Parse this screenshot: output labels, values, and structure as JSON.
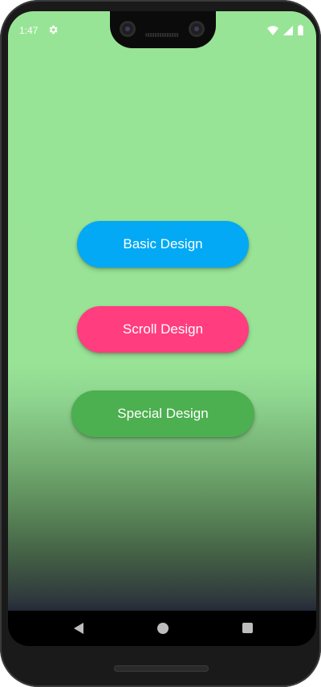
{
  "status_bar": {
    "time": "1:47",
    "icons": [
      "gear-icon",
      "wifi-icon",
      "signal-icon",
      "battery-icon"
    ]
  },
  "buttons": {
    "basic": {
      "label": "Basic Design",
      "color": "#03a9f4"
    },
    "scroll": {
      "label": "Scroll Design",
      "color": "#ff3d7f"
    },
    "special": {
      "label": "Special Design",
      "color": "#4caf50"
    }
  },
  "background": {
    "color_top": "#98e496",
    "color_bottom": "#1e2230"
  },
  "nav_bar": {
    "icons": [
      "back-icon",
      "home-icon",
      "recents-icon"
    ]
  }
}
